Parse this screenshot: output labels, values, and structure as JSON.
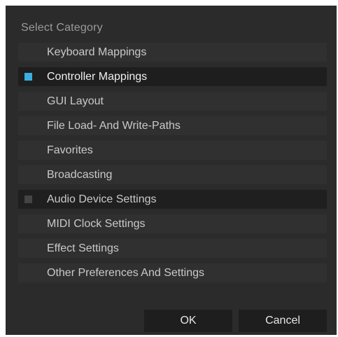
{
  "dialog": {
    "title": "Select Category",
    "categories": [
      {
        "label": "Keyboard Mappings",
        "checked": false
      },
      {
        "label": "Controller Mappings",
        "checked": true
      },
      {
        "label": "GUI Layout",
        "checked": false
      },
      {
        "label": "File Load- And Write-Paths",
        "checked": false
      },
      {
        "label": "Favorites",
        "checked": false
      },
      {
        "label": "Broadcasting",
        "checked": false
      },
      {
        "label": "Audio Device Settings",
        "checked": false
      },
      {
        "label": "MIDI Clock Settings",
        "checked": false
      },
      {
        "label": "Effect Settings",
        "checked": false
      },
      {
        "label": "Other Preferences And Settings",
        "checked": false
      }
    ],
    "ok_label": "OK",
    "cancel_label": "Cancel"
  },
  "colors": {
    "background": "#2b2b2b",
    "row": "#303030",
    "selected_row": "#1e1e1e",
    "accent": "#3ab0e2"
  }
}
